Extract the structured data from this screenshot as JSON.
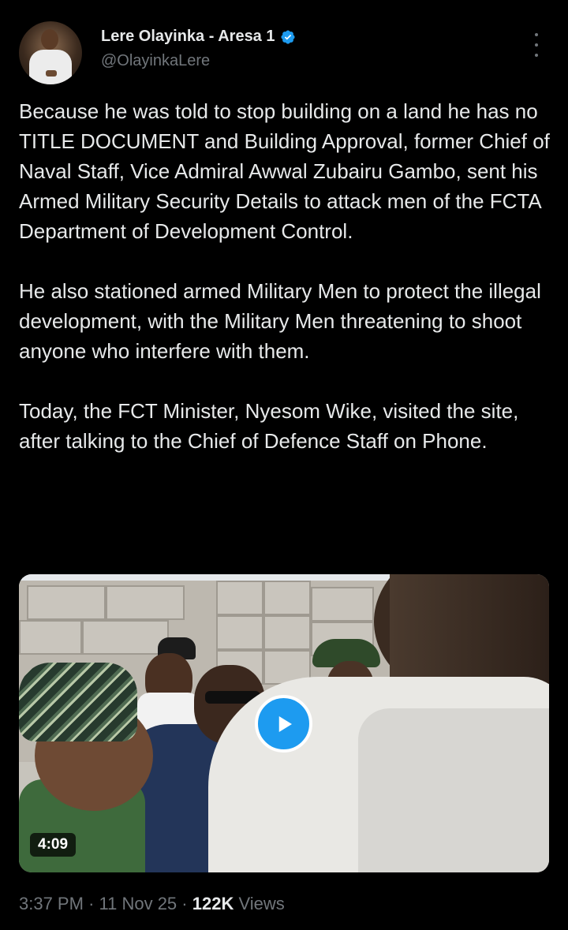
{
  "tweet": {
    "author": {
      "display_name": "Lere Olayinka - Aresa 1",
      "handle": "@OlayinkaLere",
      "verified": true
    },
    "paragraphs": [
      "Because he was told to stop building on a land he has no TITLE DOCUMENT and Building Approval, former Chief of Naval Staff,  Vice Admiral Awwal Zubairu Gambo, sent his Armed Military Security Details to attack men of the FCTA Department of Development Control.",
      "He also stationed armed Military Men to protect the illegal development, with the Military Men threatening to shoot anyone who interfere with them.",
      "Today, the FCT Minister,  Nyesom Wike,  visited the site, after talking to the Chief of Defence Staff on Phone."
    ],
    "video": {
      "duration": "4:09"
    },
    "meta": {
      "time": "3:37 PM",
      "separator": "·",
      "date": "11 Nov 25",
      "views_count": "122K",
      "views_label": "Views"
    }
  },
  "colors": {
    "background": "#000000",
    "text": "#e7e9ea",
    "secondary": "#71767b",
    "accent": "#1d9bf0"
  },
  "icons": {
    "verified": "verified-badge-icon",
    "more": "more-vertical-icon",
    "play": "play-icon"
  }
}
